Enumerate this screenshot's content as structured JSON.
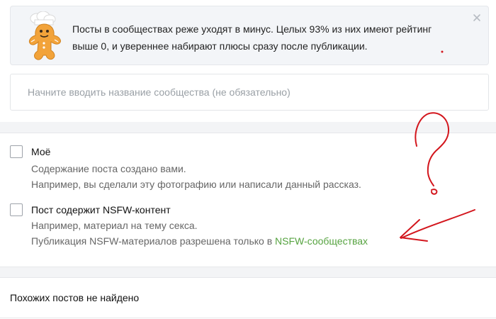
{
  "tip": {
    "line1": "Посты в сообществах реже уходят в минус. Целых 93% из них имеют рейтинг",
    "line2": "выше 0, и увереннее набирают плюсы сразу после публикации."
  },
  "community": {
    "placeholder": "Начните вводить название сообщества (не обязательно)"
  },
  "options": {
    "mine": {
      "label": "Моё",
      "line1": "Содержание поста создано вами.",
      "line2": "Например, вы сделали эту фотографию или написали данный рассказ."
    },
    "nsfw": {
      "label": "Пост содержит NSFW-контент",
      "line1": "Например, материал на тему секса.",
      "line2_prefix": "Публикация NSFW-материалов разрешена только в ",
      "line2_link": "NSFW-сообществах"
    }
  },
  "similar": {
    "text": "Похожих постов не найдено"
  },
  "colors": {
    "link": "#56a340",
    "annotation": "#d3161d",
    "panel_bg": "#f3f5f8"
  },
  "icons": {
    "tip_mascot": "chef-gingerbread-mascot",
    "tip_close": "close-icon"
  }
}
